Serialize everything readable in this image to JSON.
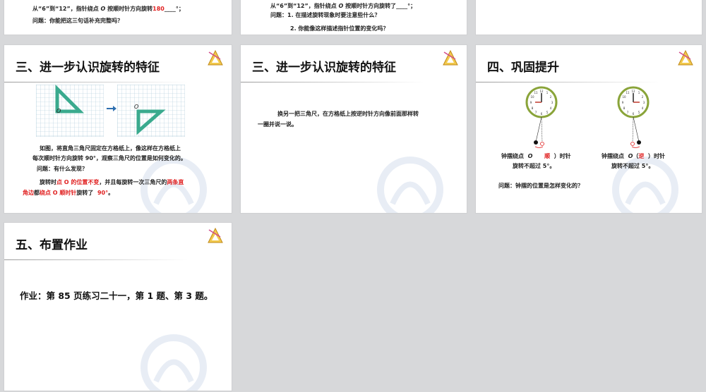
{
  "top_left": {
    "line1_a": "从“6”到“12”，指针绕点",
    "line1_o": "O",
    "line1_b": "按顺时针方向旋转",
    "line1_ans": "180",
    "line1_end": "°；",
    "line2": "问题：你能把这三句话补充完整吗？"
  },
  "top_mid": {
    "line1_a": "从“6”到“12”，指针绕点",
    "line1_o": "O",
    "line1_b": "按顺时针方向旋转了____°；",
    "q1": "问题：1. 在描述旋转现象时要注意些什么？",
    "q2": "2. 你能像这样描述指针位置的变化吗？"
  },
  "slide_a": {
    "title": "三、进一步认识旋转的特征",
    "label_o1": "O",
    "label_o2": "O",
    "p1": "如图，将直角三角尺固定在方格纸上，像这样在方格纸上",
    "p2": "每次顺时针方向旋转 90°，观察三角尺的位置是如何变化的。",
    "p3": "问题：有什么发现？",
    "a_1": "旋转时",
    "a_2": "点 O 的",
    "a_3": "位置不变",
    "a_4": "，并且每旋转一次三角尺的",
    "a_5": "两条直",
    "b_1": "角边",
    "b_2": "都",
    "b_3": "绕点 O 顺时针",
    "b_4": "旋转了",
    "b_5": "90°",
    "b_6": "。"
  },
  "slide_b": {
    "title": "三、进一步认识旋转的特征",
    "p1": "换另一把三角尺，在方格纸上按逆时针方向像前面那样转",
    "p2": "一圈并说一说。"
  },
  "slide_c": {
    "title": "四、巩固提升",
    "left_1": "钟摆绕点",
    "left_o": "O",
    "left_ans": "顺",
    "left_2": "）时针",
    "left_open": "（",
    "left_3": "旋转不超过 5°。",
    "right_1": "钟摆绕点",
    "right_o": "O",
    "right_open": "（",
    "right_ans": "逆",
    "right_2": "）时针",
    "right_3": "旋转不超过 5°。",
    "question": "问题：钟摆的位置是怎样变化的？"
  },
  "slide_d": {
    "title": "五、布置作业",
    "homework": "作业：第 85 页练习二十一，第 1 题、第 3 题。"
  },
  "colors": {
    "accent_red": "#e02020",
    "triangle": "#3aaa8e",
    "clock_rim": "#8aa43a"
  }
}
